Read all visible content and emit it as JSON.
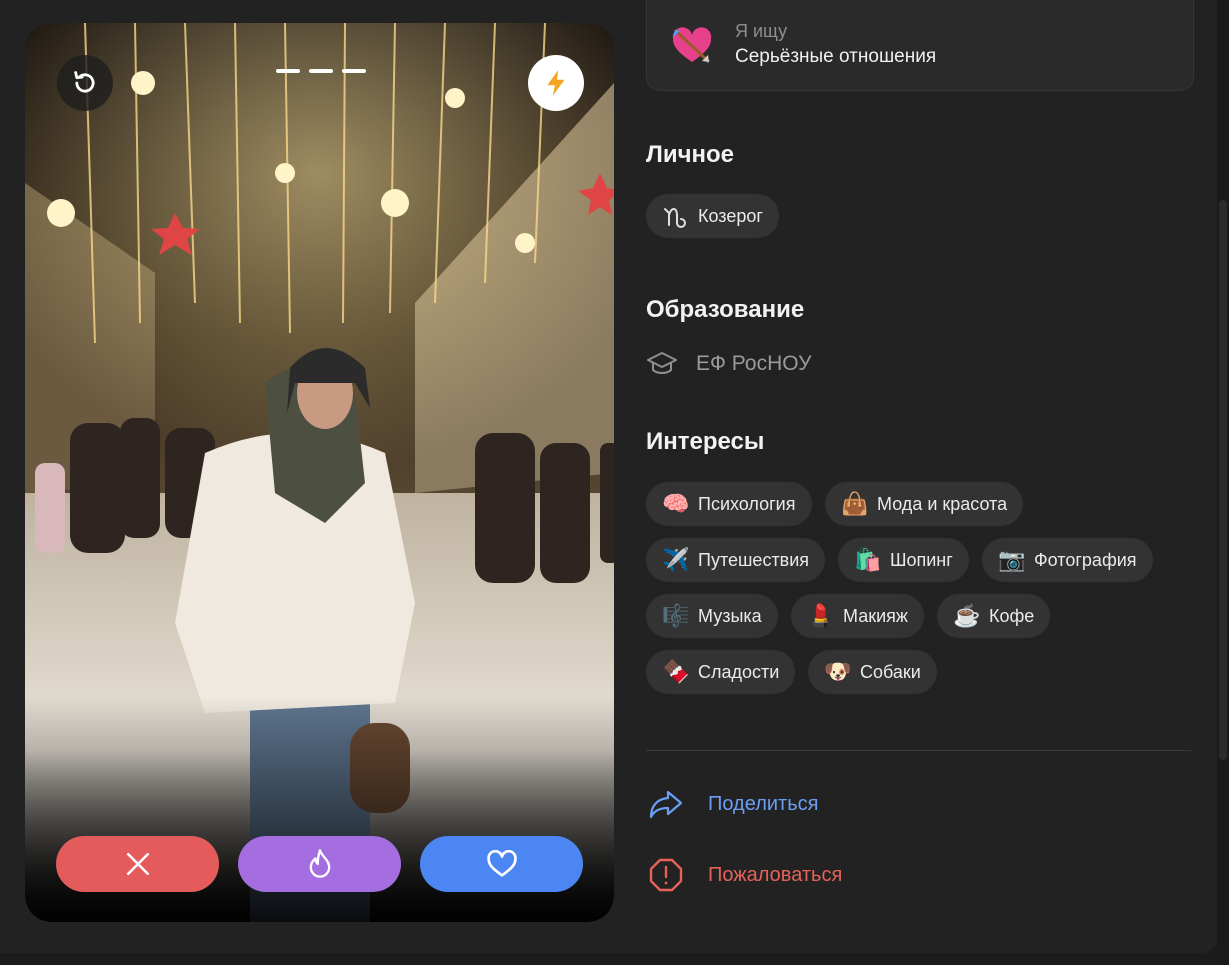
{
  "looking_for": {
    "label": "Я ищу",
    "value": "Серьёзные отношения",
    "icon": "cupid-heart-icon"
  },
  "personal": {
    "title": "Личное",
    "zodiac": {
      "label": "Козерог",
      "icon": "capricorn-icon"
    }
  },
  "education": {
    "title": "Образование",
    "school": "ЕФ РосНОУ",
    "icon": "graduation-cap-icon"
  },
  "interests": {
    "title": "Интересы",
    "items": [
      {
        "label": "Психология",
        "emoji": "🧠"
      },
      {
        "label": "Мода и красота",
        "emoji": "👜"
      },
      {
        "label": "Путешествия",
        "emoji": "✈️"
      },
      {
        "label": "Шопинг",
        "emoji": "🛍️"
      },
      {
        "label": "Фотография",
        "emoji": "📷"
      },
      {
        "label": "Музыка",
        "emoji": "🎼"
      },
      {
        "label": "Макияж",
        "emoji": "💄"
      },
      {
        "label": "Кофе",
        "emoji": "☕"
      },
      {
        "label": "Сладости",
        "emoji": "🍫"
      },
      {
        "label": "Собаки",
        "emoji": "🐶"
      }
    ]
  },
  "links": {
    "share": "Поделиться",
    "report": "Пожаловаться"
  },
  "card": {
    "photo_count": 3,
    "active_photo": 1
  },
  "colors": {
    "dislike": "#e35b5b",
    "superlike": "#a56ee0",
    "like": "#4b86f3",
    "share": "#6a9ff5",
    "report": "#e5625a"
  }
}
